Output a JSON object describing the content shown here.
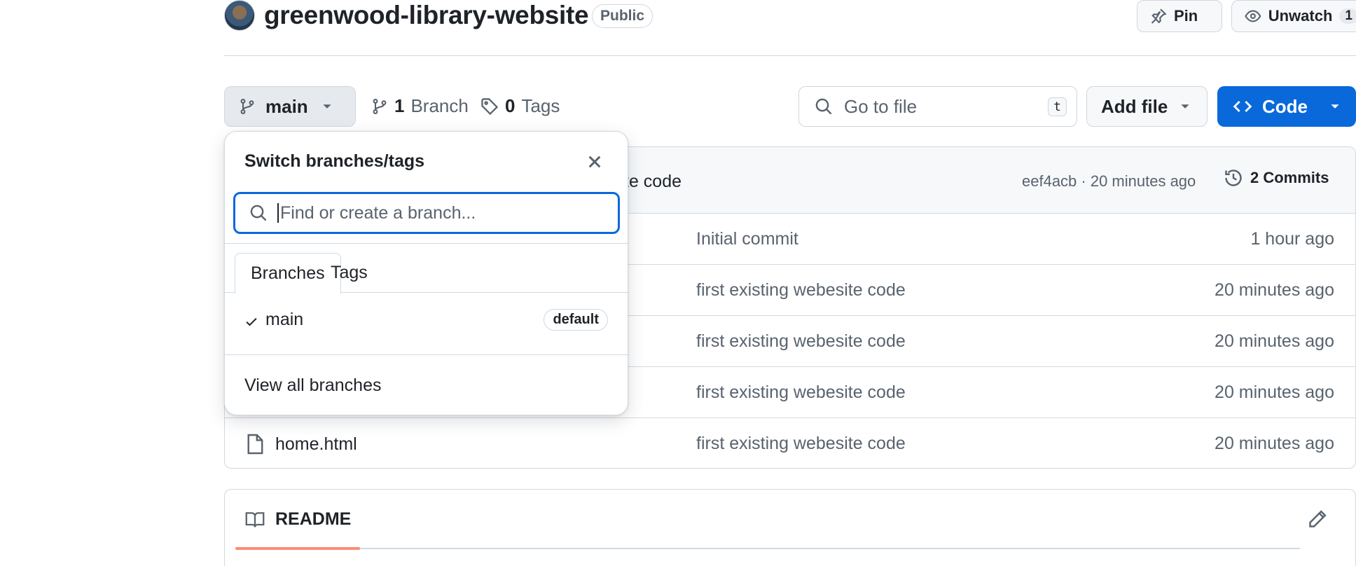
{
  "repo": {
    "name": "greenwood-library-website",
    "visibility": "Public"
  },
  "header_actions": {
    "pin_label": "Pin",
    "unwatch_label": "Unwatch",
    "watch_count": "1"
  },
  "branch_bar": {
    "current_branch": "main",
    "branch_count": "1",
    "branch_word": "Branch",
    "tag_count": "0",
    "tag_word": "Tags",
    "goto_placeholder": "Go to file",
    "goto_shortcut": "t",
    "add_file_label": "Add file",
    "code_label": "Code"
  },
  "latest_commit": {
    "message": "te code",
    "meta": "eef4acb · 20 minutes ago",
    "commits_label": "2 Commits"
  },
  "files": [
    {
      "name": "",
      "message": "Initial commit",
      "time": "1 hour ago"
    },
    {
      "name": "",
      "message": "first existing webesite code",
      "time": "20 minutes ago"
    },
    {
      "name": "",
      "message": "first existing webesite code",
      "time": "20 minutes ago"
    },
    {
      "name": "",
      "message": "first existing webesite code",
      "time": "20 minutes ago"
    },
    {
      "name": "home.html",
      "message": "first existing webesite code",
      "time": "20 minutes ago"
    }
  ],
  "readme": {
    "label": "README"
  },
  "branch_dropdown": {
    "title": "Switch branches/tags",
    "search_placeholder": "Find or create a branch...",
    "tabs": [
      {
        "label": "Branches",
        "active": true
      },
      {
        "label": "Tags",
        "active": false
      }
    ],
    "branches": [
      {
        "name": "main",
        "badge": "default",
        "selected": true
      }
    ],
    "view_all_label": "View all branches"
  },
  "colors": {
    "accent_blue": "#0969da",
    "readme_underline": "#fd8c73",
    "border": "#d1d9e0",
    "muted_text": "#59636e"
  }
}
